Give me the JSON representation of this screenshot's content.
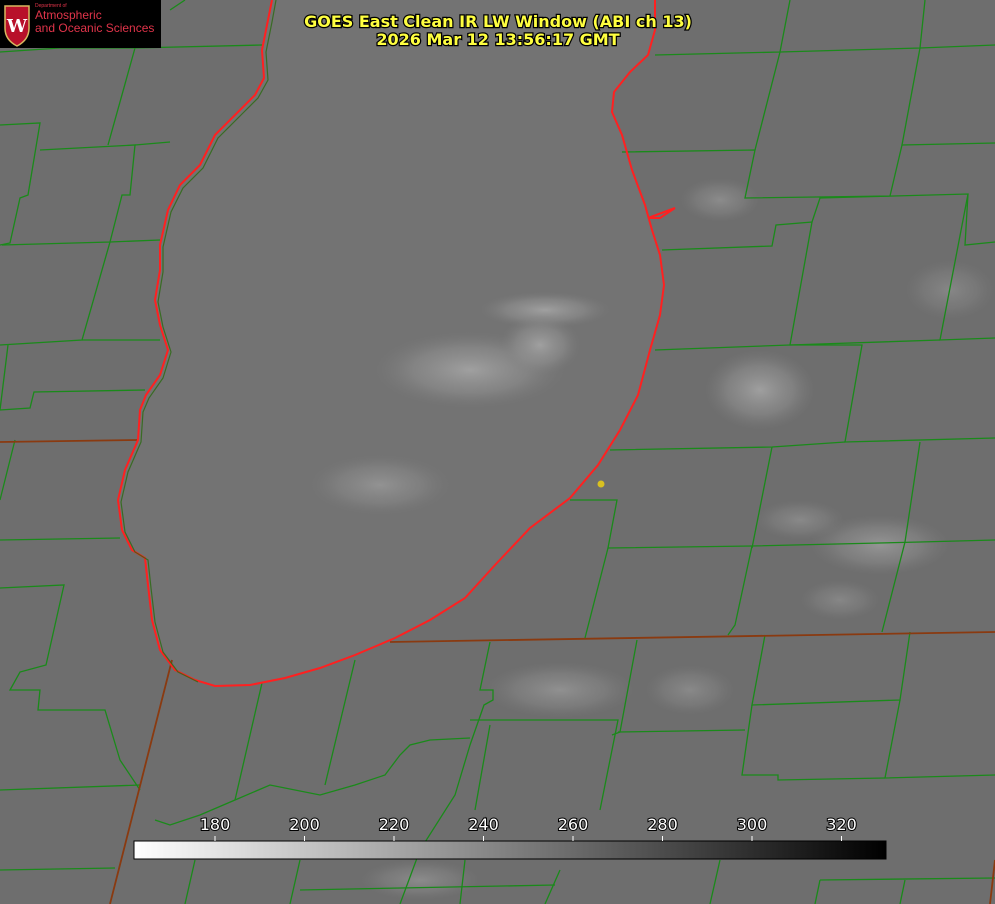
{
  "header": {
    "title": "GOES East Clean IR LW Window (ABI ch 13)",
    "timestamp": "2026 Mar 12 13:56:17 GMT"
  },
  "logo": {
    "department": "Department of",
    "line1": "Atmospheric",
    "line2": "and Oceanic Sciences",
    "emblem_letter": "W"
  },
  "colorbar": {
    "ticks": [
      "180",
      "200",
      "220",
      "240",
      "260",
      "280",
      "300",
      "320"
    ],
    "gradient_start": "#ffffff",
    "gradient_end": "#000000"
  },
  "colors": {
    "background": "#6e6e6e",
    "lake": "#737373",
    "county_lines": "#1a8a1a",
    "shoreline": "#ff2020",
    "state_lines": "#8a3a10",
    "marker": "#d8c020",
    "title": "#ffff40"
  },
  "icons": {
    "logo_emblem": "university-crest-icon",
    "marker": "location-dot-icon"
  }
}
